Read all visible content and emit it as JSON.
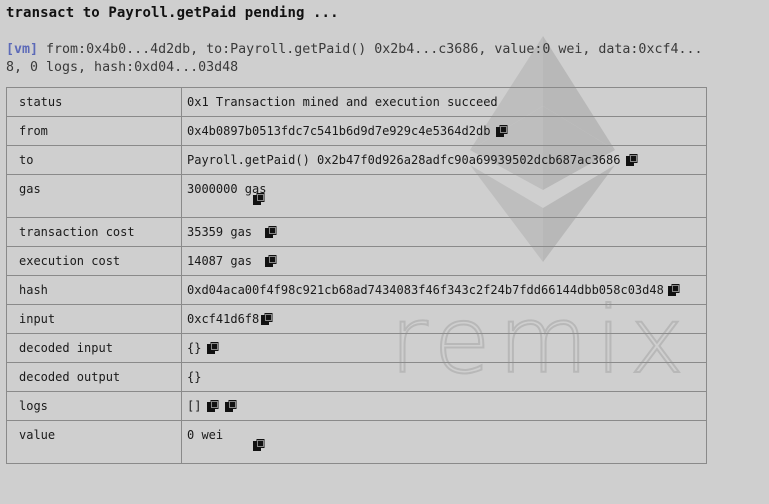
{
  "title": "transact to Payroll.getPaid pending ...",
  "log": {
    "tag": "[vm]",
    "line1": " from:0x4b0...4d2db, to:Payroll.getPaid() 0x2b4...c3686, value:0 wei, data:0xcf4...",
    "line2": "8, 0 logs, hash:0xd04...03d48"
  },
  "watermark_text": "remix",
  "rows": [
    {
      "key": "status",
      "value": "0x1 Transaction mined and execution succeed"
    },
    {
      "key": "from",
      "value": "0x4b0897b0513fdc7c541b6d9d7e929c4e5364d2db"
    },
    {
      "key": "to",
      "value": "Payroll.getPaid() 0x2b47f0d926a28adfc90a69939502dcb687ac3686"
    },
    {
      "key": "gas",
      "value": "3000000 gas"
    },
    {
      "key": "transaction cost",
      "value": "35359 gas "
    },
    {
      "key": "execution cost",
      "value": "14087 gas "
    },
    {
      "key": "hash",
      "value": "0xd04aca00f4f98c921cb68ad7434083f46f343c2f24b7fdd66144dbb058c03d48"
    },
    {
      "key": "input",
      "value": "0xcf41d6f8"
    },
    {
      "key": "decoded input",
      "value": "{}"
    },
    {
      "key": "decoded output",
      "value": "{}"
    },
    {
      "key": "logs",
      "value": "[]"
    },
    {
      "key": "value",
      "value": "0 wei"
    }
  ],
  "icons": {
    "copy": "clipboard-copy-icon"
  },
  "colors": {
    "background": "#cfcfcf",
    "vm_tag": "#5c6ab8",
    "border": "#8a8a8a"
  }
}
